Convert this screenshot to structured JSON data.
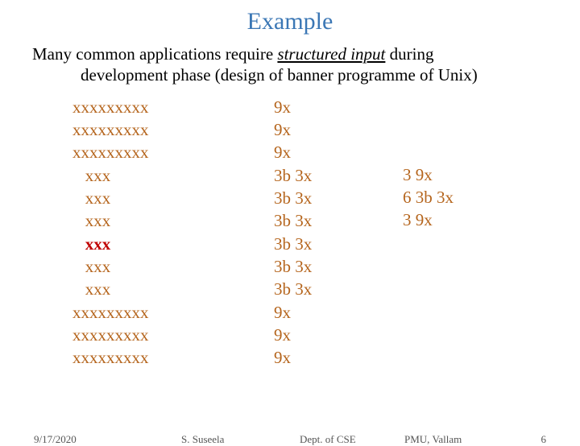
{
  "title": "Example",
  "paragraph": {
    "line1_pre": "Many common applications require ",
    "line1_em": "structured input",
    "line1_post": " during",
    "line2": "development phase (design of banner programme of Unix)"
  },
  "columns": {
    "c1": {
      "r0": "xxxxxxxxx",
      "r1": "xxxxxxxxx",
      "r2": "xxxxxxxxx",
      "r3": "   xxx",
      "r4": "   xxx",
      "r5": "   xxx",
      "r6": "   xxx",
      "r7": "   xxx",
      "r8": "   xxx",
      "r9": "xxxxxxxxx",
      "r10": "xxxxxxxxx",
      "r11": "xxxxxxxxx"
    },
    "c2": {
      "r0": "9x",
      "r1": "9x",
      "r2": "9x",
      "r3": "3b 3x",
      "r4": "3b 3x",
      "r5": "3b 3x",
      "r6": "3b 3x",
      "r7": "3b 3x",
      "r8": "3b 3x",
      "r9": "9x",
      "r10": "9x",
      "r11": "9x"
    },
    "c3": {
      "r0": "3 9x",
      "r1": "6 3b 3x",
      "r2": "3 9x"
    }
  },
  "footer": {
    "date": "9/17/2020",
    "author": "S. Suseela",
    "dept": "Dept. of CSE",
    "org": "PMU, Vallam",
    "page": "6"
  }
}
